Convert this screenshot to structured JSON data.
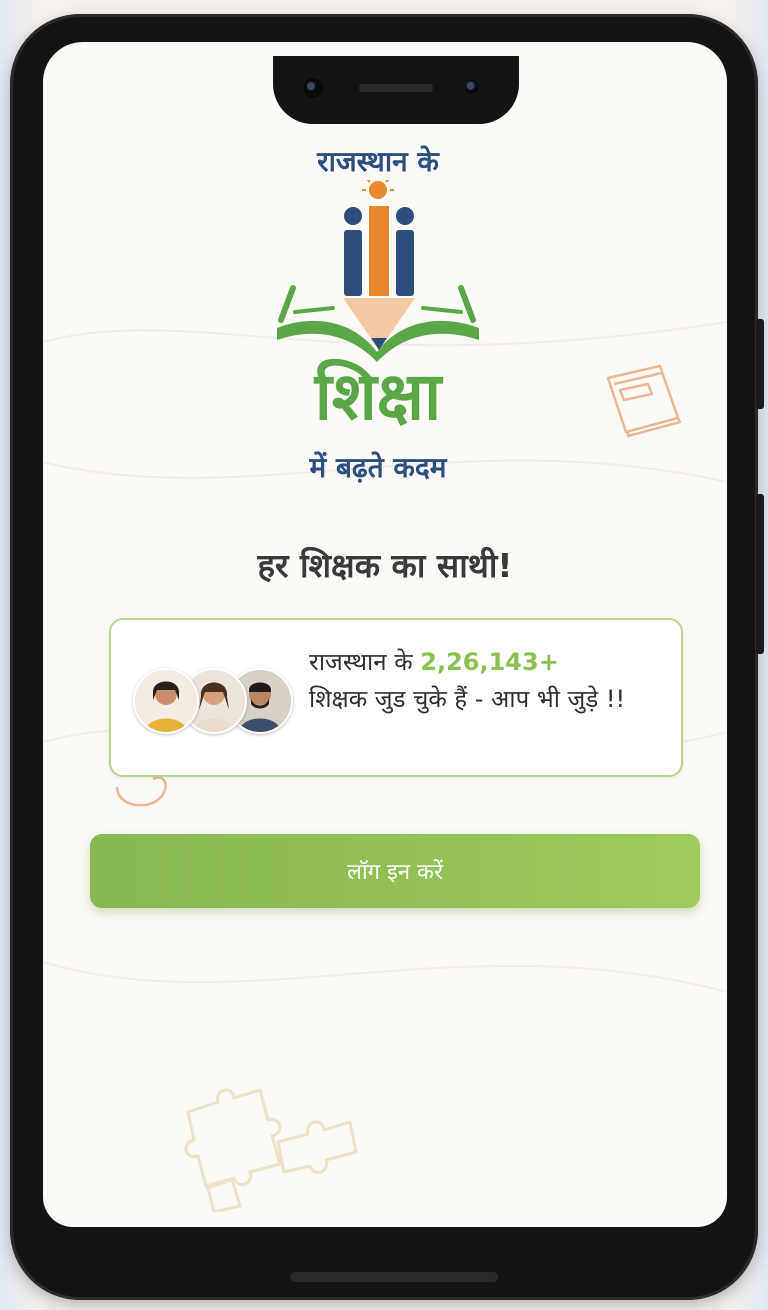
{
  "logo": {
    "top_text": "राजस्थान के",
    "main_text": "शिक्षा",
    "sub_text": "में बढ़ते कदम",
    "colors": {
      "blue": "#2e4f7e",
      "green": "#5aa748",
      "orange": "#e8892f"
    }
  },
  "tagline": "हर शिक्षक का साथी!",
  "info_card": {
    "prefix": "राजस्थान के ",
    "count": "2,26,143+",
    "suffix": "शिक्षक जुड चुके हैं - आप भी जुड़े !!",
    "count_color": "#8cc152",
    "avatars": [
      "teacher-avatar-1",
      "teacher-avatar-2",
      "teacher-avatar-3"
    ]
  },
  "login": {
    "label": "लॉग इन करें",
    "color": "#93c057"
  },
  "decorations": [
    "book-doodle-icon",
    "heart-doodle-icon",
    "puzzle-doodle-icon"
  ]
}
